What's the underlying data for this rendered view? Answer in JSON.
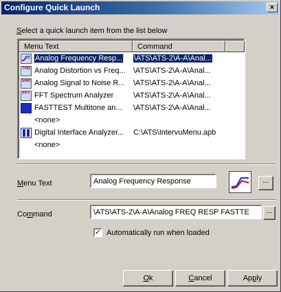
{
  "window": {
    "title": "Configure Quick Launch",
    "close_glyph": "×"
  },
  "prompt": {
    "prefix": "S",
    "rest": "elect a quick launch item from the list below"
  },
  "list": {
    "columns": [
      "Menu Text",
      "Command"
    ],
    "rows": [
      {
        "icon": "frequency-response-icon",
        "menu": "Analog Frequency Resp...",
        "command": "\\ATS\\ATS-2\\A-A\\Anal...",
        "selected": true
      },
      {
        "icon": "thd-icon",
        "menu": "Analog Distortion vs Freq...",
        "command": "\\ATS\\ATS-2\\A-A\\Anal..."
      },
      {
        "icon": "snr-icon",
        "menu": "Analog Signal to Noise R...",
        "command": "\\ATS\\ATS-2\\A-A\\Anal..."
      },
      {
        "icon": "fft-icon",
        "menu": "FFT Spectrum Analyzer",
        "command": "\\ATS\\ATS-2\\A-A\\Anal..."
      },
      {
        "icon": "multitone-icon",
        "menu": "FASTTEST Multitone an...",
        "command": "\\ATS\\ATS-2\\A-A\\Anal..."
      },
      {
        "icon": "",
        "menu": "<none>",
        "command": ""
      },
      {
        "icon": "digital-interface-icon",
        "menu": "Digital Interface Analyzer...",
        "command": "C:\\ATS\\IntervuMenu.apb"
      },
      {
        "icon": "",
        "menu": "<none>",
        "command": ""
      }
    ],
    "icon_text": {
      "thd": "THD",
      "snr": "SNR",
      "fft": "FFT"
    }
  },
  "menu_text": {
    "label": "Menu Text",
    "label_ul": "M",
    "label_rest": "enu Text",
    "value": "Analog Frequency Response"
  },
  "command": {
    "label_pre": "Co",
    "label_ul": "m",
    "label_post": "mand",
    "value": "\\ATS\\ATS-2\\A-A\\Analog FREQ RESP FASTTE"
  },
  "browse_label": "...",
  "auto_run": {
    "label": "Automatically run when loaded",
    "checked": true,
    "check_glyph": "✓"
  },
  "buttons": {
    "ok": {
      "ul": "O",
      "rest": "k"
    },
    "cancel": {
      "ul": "C",
      "rest": "ancel"
    },
    "apply": {
      "pre": "Ap",
      "ul": "p",
      "rest": "ly"
    }
  },
  "colors": {
    "accent": "#0a246a",
    "face": "#d4d0c8",
    "curve_red": "#e01010",
    "curve_blue": "#1030e0"
  }
}
